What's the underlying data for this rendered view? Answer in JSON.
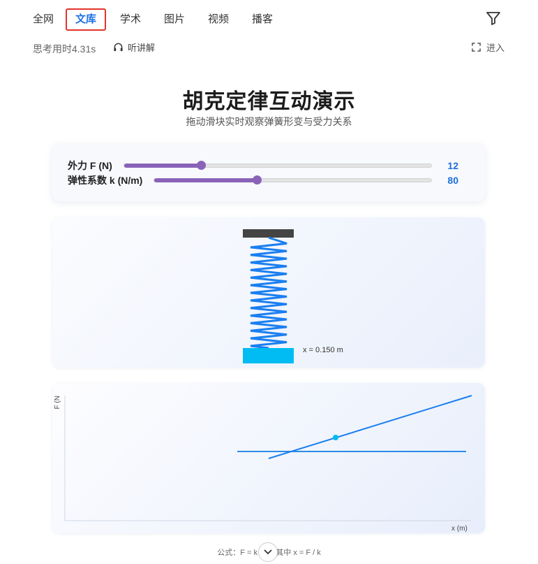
{
  "nav": {
    "tabs": [
      {
        "label": "全网"
      },
      {
        "label": "文库"
      },
      {
        "label": "学术"
      },
      {
        "label": "图片"
      },
      {
        "label": "视频"
      },
      {
        "label": "播客"
      }
    ],
    "active_tab": "文库",
    "filter_icon": "filter-icon"
  },
  "meta": {
    "think_time": "思考用时4.31s",
    "listen_label": "听讲解",
    "enter_label": "进入"
  },
  "page": {
    "title": "胡克定律互动演示",
    "subtitle": "拖动滑块实时观察弹簧形变与受力关系"
  },
  "controls": {
    "force": {
      "label": "外力 F (N)",
      "value": "12",
      "fraction": 0.25
    },
    "k": {
      "label": "弹性系数 k (N/m)",
      "value": "80",
      "fraction": 0.37
    }
  },
  "spring": {
    "displacement_label": "x = 0.150 m"
  },
  "graph": {
    "y_label": "F (N",
    "x_label": "x (m)"
  },
  "formula": "公式：F = k · x，其中 x = F / k",
  "colors": {
    "accent": "#1a6fe6",
    "slider": "#8a63b8",
    "spring": "#1a7ff0",
    "block": "#00bcf2",
    "mount": "#444444",
    "active_tab_border": "#e4332a"
  }
}
